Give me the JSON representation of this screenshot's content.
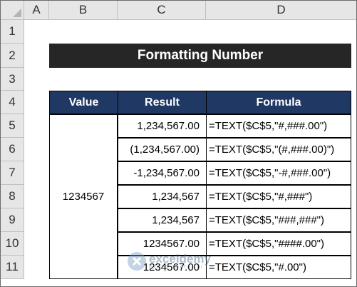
{
  "columns": [
    "A",
    "B",
    "C",
    "D"
  ],
  "rows": [
    "1",
    "2",
    "3",
    "4",
    "5",
    "6",
    "7",
    "8",
    "9",
    "10",
    "11"
  ],
  "title": "Formatting Number",
  "table": {
    "headers": [
      "Value",
      "Result",
      "Formula"
    ],
    "value": "1234567",
    "results": [
      "1,234,567.00",
      "(1,234,567.00)",
      "-1,234,567.00",
      "1,234,567",
      "1,234,567",
      "1234567.00",
      "1234567.00"
    ],
    "formulas": [
      "=TEXT($C$5,\"#,###.00\")",
      "=TEXT($C$5,\"(#,###.00)\")",
      "=TEXT($C$5,\"-#,###.00\")",
      "=TEXT($C$5,\"#,###\")",
      "=TEXT($C$5,\"###,###\")",
      "=TEXT($C$5,\"####.00\")",
      "=TEXT($C$5,\"#.00\")"
    ]
  },
  "watermark": {
    "name": "exceldemy",
    "tagline": "EXCEL · DATA · BI"
  },
  "colors": {
    "title_bg": "#262626",
    "header_bg": "#1f3864",
    "grid_header_bg": "#e6e6e6"
  }
}
